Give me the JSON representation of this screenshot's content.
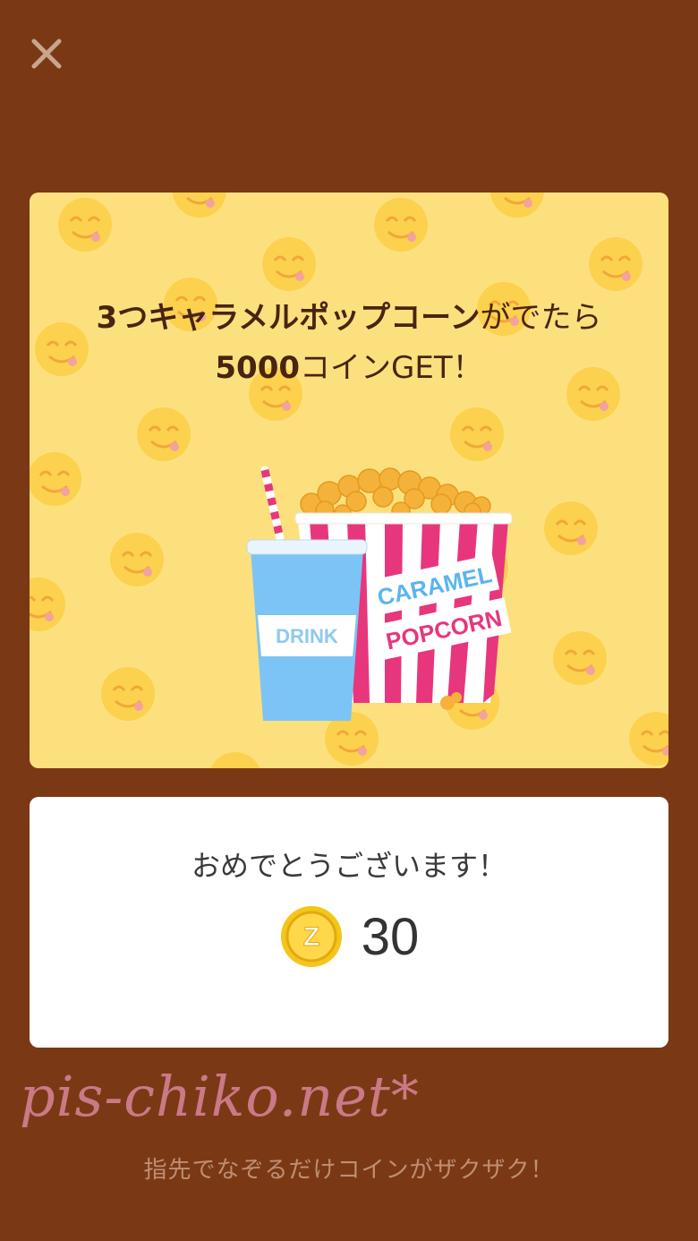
{
  "header": {
    "close_icon": "close-icon"
  },
  "banner": {
    "line1_bold": "3つキャラメルポップコーン",
    "line1_rest": "がでたら",
    "line2_bold": "5000",
    "line2_rest": "コインGET！",
    "drink_label": "DRINK",
    "popcorn_label_1": "CARAMEL",
    "popcorn_label_2": "POPCORN",
    "background_color": "#fde07e"
  },
  "result": {
    "message": "おめでとうございます！",
    "coin_icon": "coin-icon",
    "coin_letter": "Z",
    "amount": "30"
  },
  "footer": {
    "watermark": "pis-chiko.net*",
    "tagline": "指先でなぞるだけコインがザクザク！"
  },
  "colors": {
    "page_background": "#7a3914",
    "accent_pink": "#e8367c",
    "coin_gold": "#f5c518"
  }
}
